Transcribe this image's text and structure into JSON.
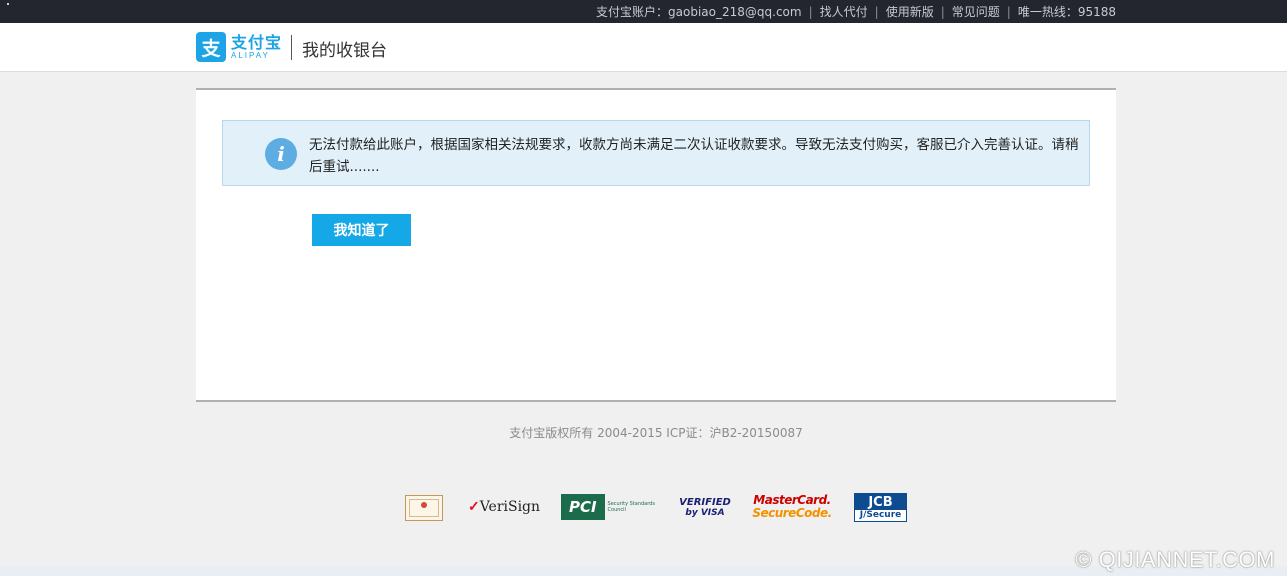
{
  "topbar": {
    "account_label": "支付宝账户：gaobiao_218@qq.com",
    "links": [
      "找人代付",
      "使用新版",
      "常见问题"
    ],
    "hotline": "唯一热线：95188"
  },
  "header": {
    "logo_icon_char": "支",
    "logo_cn": "支付宝",
    "logo_en": "ALIPAY",
    "title": "我的收银台"
  },
  "notice": {
    "icon": "info-icon",
    "message": "无法付款给此账户，根据国家相关法规要求，收款方尚未满足二次认证收款要求。导致无法支付购买，客服已介入完善认证。请稍后重试......."
  },
  "actions": {
    "confirm_label": "我知道了"
  },
  "footer": {
    "copyright": "支付宝版权所有 2004-2015 ICP证：沪B2-20150087"
  },
  "certifications": {
    "verisign": "VeriSign",
    "pci": "PCI",
    "pci_sub": "Security Standards Council",
    "visa_1": "VERIFIED",
    "visa_2": "by VISA",
    "mc_1": "MasterCard.",
    "mc_2": "SecureCode.",
    "jcb_1": "JCB",
    "jcb_2": "J/Secure"
  },
  "watermark": "© QIJIANNET.COM",
  "colors": {
    "topbar_bg": "#24262f",
    "brand_blue": "#1ca4e6",
    "button_blue": "#15a8e6",
    "notice_bg": "#e2f1f9",
    "page_bg": "#f0f0f0"
  }
}
